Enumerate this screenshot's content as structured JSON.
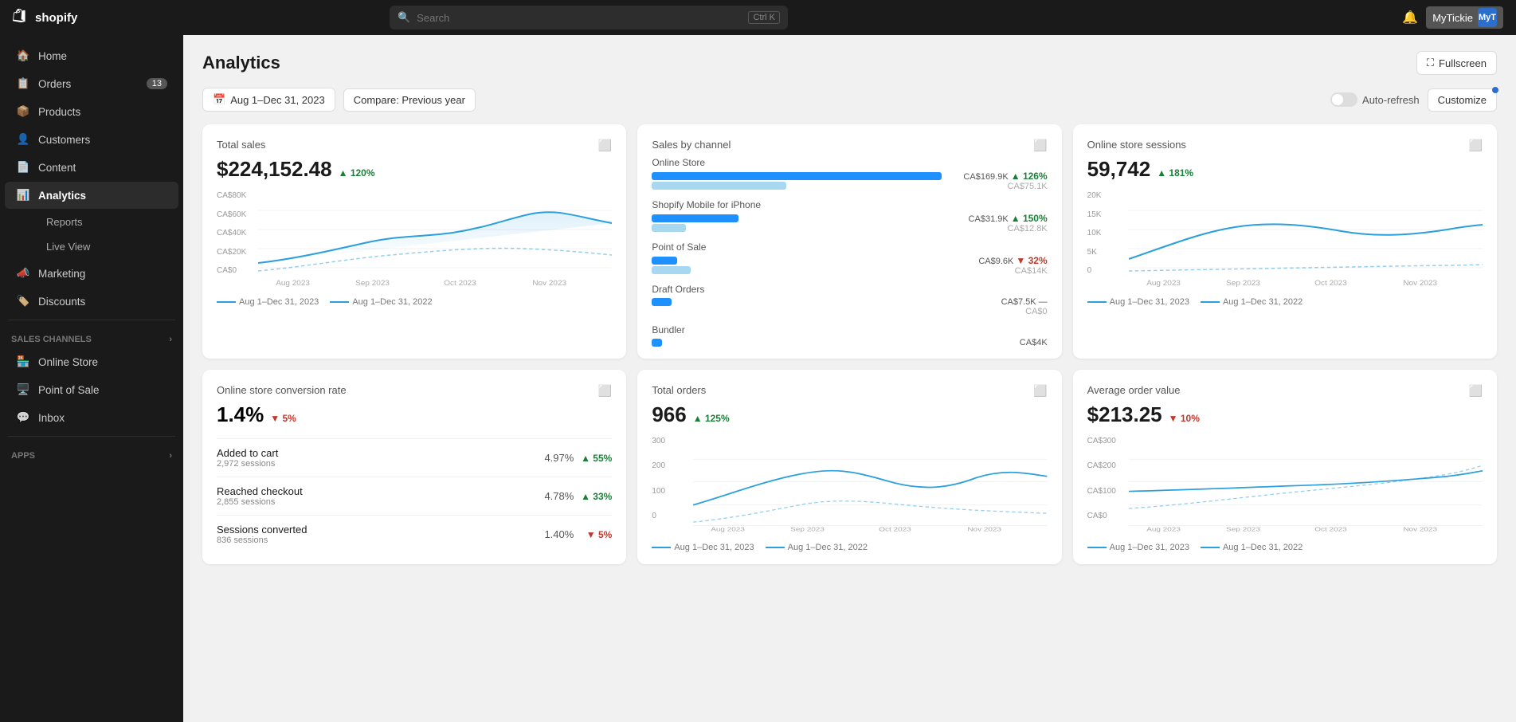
{
  "topbar": {
    "logo_text": "shopify",
    "search_placeholder": "Search",
    "search_shortcut": "Ctrl K",
    "store_name": "MyTickie",
    "avatar_initials": "MyT",
    "notification_icon": "🔔"
  },
  "sidebar": {
    "items": [
      {
        "id": "home",
        "label": "Home",
        "icon": "home"
      },
      {
        "id": "orders",
        "label": "Orders",
        "icon": "orders",
        "badge": "13"
      },
      {
        "id": "products",
        "label": "Products",
        "icon": "products"
      },
      {
        "id": "customers",
        "label": "Customers",
        "icon": "customers"
      },
      {
        "id": "content",
        "label": "Content",
        "icon": "content"
      },
      {
        "id": "analytics",
        "label": "Analytics",
        "icon": "analytics",
        "active": true
      },
      {
        "id": "marketing",
        "label": "Marketing",
        "icon": "marketing"
      },
      {
        "id": "discounts",
        "label": "Discounts",
        "icon": "discounts"
      }
    ],
    "analytics_sub": [
      {
        "id": "reports",
        "label": "Reports"
      },
      {
        "id": "live-view",
        "label": "Live View"
      }
    ],
    "sales_channels_label": "Sales channels",
    "sales_channels": [
      {
        "id": "online-store",
        "label": "Online Store",
        "icon": "store"
      },
      {
        "id": "point-of-sale",
        "label": "Point of Sale",
        "icon": "pos"
      },
      {
        "id": "inbox",
        "label": "Inbox",
        "icon": "inbox"
      }
    ],
    "apps_label": "Apps"
  },
  "page": {
    "title": "Analytics",
    "fullscreen_label": "Fullscreen",
    "date_range": "Aug 1–Dec 31, 2023",
    "compare_label": "Compare: Previous year",
    "auto_refresh_label": "Auto-refresh",
    "customize_label": "Customize"
  },
  "cards": {
    "total_sales": {
      "title": "Total sales",
      "value": "$224,152.48",
      "change": "120%",
      "change_dir": "up",
      "y_labels": [
        "CA$80K",
        "CA$60K",
        "CA$40K",
        "CA$20K",
        "CA$0"
      ],
      "x_labels": [
        "Aug 2023",
        "Sep 2023",
        "Oct 2023",
        "Nov 2023"
      ],
      "legend_current": "Aug 1–Dec 31, 2023",
      "legend_prev": "Aug 1–Dec 31, 2022"
    },
    "sales_by_channel": {
      "title": "Sales by channel",
      "channels": [
        {
          "name": "Online Store",
          "value": "CA$169.9K",
          "prev": "CA$75.1K",
          "change": "126%",
          "change_dir": "up",
          "bar_pct": 95,
          "bar_prev_pct": 44
        },
        {
          "name": "Shopify Mobile for iPhone",
          "value": "CA$31.9K",
          "prev": "CA$12.8K",
          "change": "150%",
          "change_dir": "up",
          "bar_pct": 28,
          "bar_prev_pct": 11
        },
        {
          "name": "Point of Sale",
          "value": "CA$9.6K",
          "prev": "CA$14K",
          "change": "32%",
          "change_dir": "down",
          "bar_pct": 8,
          "bar_prev_pct": 12
        },
        {
          "name": "Draft Orders",
          "value": "CA$7.5K",
          "prev": "CA$0",
          "change": "—",
          "change_dir": "neutral",
          "bar_pct": 6,
          "bar_prev_pct": 0
        },
        {
          "name": "Bundler",
          "value": "CA$4K",
          "prev": "",
          "change": "",
          "change_dir": "neutral",
          "bar_pct": 3,
          "bar_prev_pct": 0
        }
      ]
    },
    "online_store_sessions": {
      "title": "Online store sessions",
      "value": "59,742",
      "change": "181%",
      "change_dir": "up",
      "y_labels": [
        "20K",
        "15K",
        "10K",
        "5K",
        "0"
      ],
      "x_labels": [
        "Aug 2023",
        "Sep 2023",
        "Oct 2023",
        "Nov 2023"
      ],
      "legend_current": "Aug 1–Dec 31, 2023",
      "legend_prev": "Aug 1–Dec 31, 2022"
    },
    "conversion_rate": {
      "title": "Online store conversion rate",
      "value": "1.4%",
      "change": "5%",
      "change_dir": "down",
      "rows": [
        {
          "label": "Added to cart",
          "sub": "2,972 sessions",
          "pct": "4.97%",
          "change": "55%",
          "change_dir": "up"
        },
        {
          "label": "Reached checkout",
          "sub": "2,855 sessions",
          "pct": "4.78%",
          "change": "33%",
          "change_dir": "up"
        },
        {
          "label": "Sessions converted",
          "sub": "836 sessions",
          "pct": "1.40%",
          "change": "5%",
          "change_dir": "down"
        }
      ]
    },
    "total_orders": {
      "title": "Total orders",
      "value": "966",
      "change": "125%",
      "change_dir": "up",
      "y_labels": [
        "300",
        "200",
        "100",
        "0"
      ],
      "x_labels": [
        "Aug 2023",
        "Sep 2023",
        "Oct 2023",
        "Nov 2023"
      ],
      "legend_current": "Aug 1–Dec 31, 2023",
      "legend_prev": "Aug 1–Dec 31, 2022"
    },
    "avg_order_value": {
      "title": "Average order value",
      "value": "$213.25",
      "change": "10%",
      "change_dir": "down",
      "y_labels": [
        "CA$300",
        "CA$200",
        "CA$100",
        "CA$0"
      ],
      "x_labels": [
        "Aug 2023",
        "Sep 2023",
        "Oct 2023",
        "Nov 2023"
      ],
      "legend_current": "Aug 1–Dec 31, 2023",
      "legend_prev": "Aug 1–Dec 31, 2022"
    }
  }
}
